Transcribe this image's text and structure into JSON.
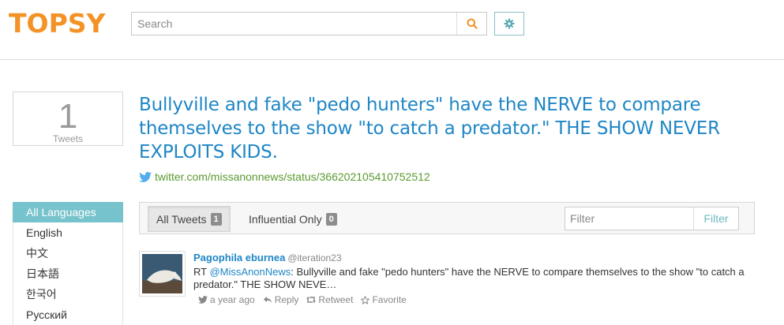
{
  "header": {
    "logo": "TOPSY",
    "search_placeholder": "Search",
    "search_icon": "search-icon",
    "settings_icon": "gear-icon"
  },
  "stats": {
    "count": "1",
    "label": "Tweets"
  },
  "headline": "Bullyville and fake \"pedo hunters\" have the NERVE to compare themselves to the show \"to catch a predator.\" THE SHOW NEVER EXPLOITS KIDS.",
  "source_link": "twitter.com/missanonnews/status/366202105410752512",
  "languages": [
    {
      "label": "All Languages",
      "active": true
    },
    {
      "label": "English",
      "active": false
    },
    {
      "label": "中文",
      "active": false
    },
    {
      "label": "日本語",
      "active": false
    },
    {
      "label": "한국어",
      "active": false
    },
    {
      "label": "Русский",
      "active": false
    }
  ],
  "tabs": {
    "all": {
      "label": "All Tweets",
      "count": "1"
    },
    "influential": {
      "label": "Influential Only",
      "count": "0"
    }
  },
  "filter": {
    "placeholder": "Filter",
    "button": "Filter"
  },
  "tweet": {
    "author": "Pagophila eburnea",
    "handle": "@iteration23",
    "prefix": "RT ",
    "mention": "@MissAnonNews",
    "text": ": Bullyville and fake \"pedo hunters\" have the NERVE to compare themselves to the show \"to catch a predator.\" THE SHOW NEVE…",
    "time": "a year ago",
    "reply": "Reply",
    "retweet": "Retweet",
    "favorite": "Favorite"
  },
  "colors": {
    "brand": "#f39225",
    "link": "#1e86c6",
    "accent": "#77c3cd",
    "source_link": "#5a9a2f"
  }
}
